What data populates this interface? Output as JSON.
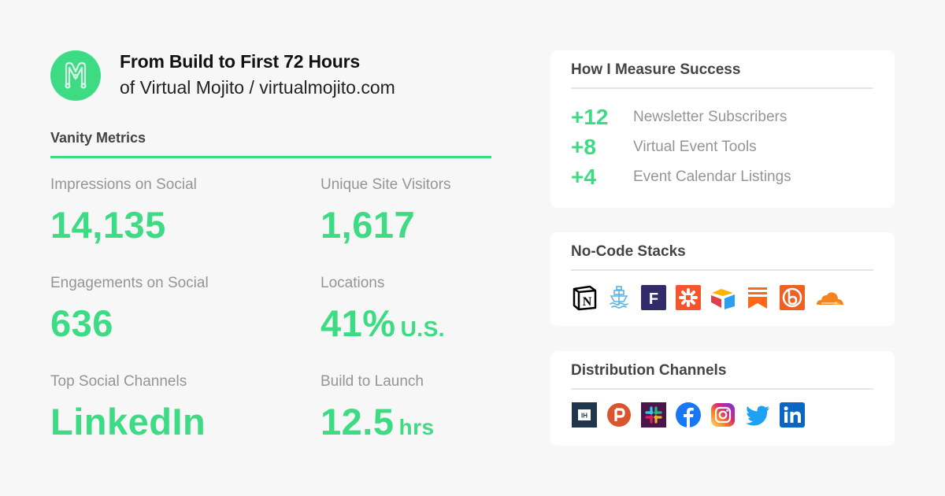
{
  "header": {
    "logo_icon": "virtual-mojito-m-logo",
    "title": "From Build to First 72 Hours",
    "subtitle": "of Virtual Mojito / virtualmojito.com"
  },
  "vanity_metrics": {
    "section_label": "Vanity Metrics",
    "items": [
      {
        "label": "Impressions on Social",
        "value": "14,135",
        "unit": ""
      },
      {
        "label": "Unique Site Visitors",
        "value": "1,617",
        "unit": ""
      },
      {
        "label": "Engagements on Social",
        "value": "636",
        "unit": ""
      },
      {
        "label": "Locations",
        "value": "41%",
        "unit": "U.S."
      },
      {
        "label": "Top Social Channels",
        "value": "LinkedIn",
        "unit": ""
      },
      {
        "label": "Build to Launch",
        "value": "12.5",
        "unit": "hrs"
      }
    ]
  },
  "success": {
    "title": "How I Measure Success",
    "items": [
      {
        "value": "+12",
        "label": "Newsletter Subscribers"
      },
      {
        "value": "+8",
        "label": "Virtual Event Tools"
      },
      {
        "value": "+4",
        "label": "Event Calendar Listings"
      }
    ]
  },
  "stacks": {
    "title": "No-Code Stacks",
    "icons": [
      "notion-icon",
      "ship-icon",
      "f-app-icon",
      "zapier-icon",
      "airtable-icon",
      "substack-icon",
      "bitly-icon",
      "cloudflare-icon"
    ]
  },
  "distribution": {
    "title": "Distribution Channels",
    "icons": [
      "indie-hackers-icon",
      "product-hunt-icon",
      "slack-icon",
      "facebook-icon",
      "instagram-icon",
      "twitter-icon",
      "linkedin-icon"
    ]
  },
  "colors": {
    "accent": "#3ddc84",
    "background": "#f7f7f7",
    "card": "#ffffff",
    "muted_text": "#959595"
  }
}
